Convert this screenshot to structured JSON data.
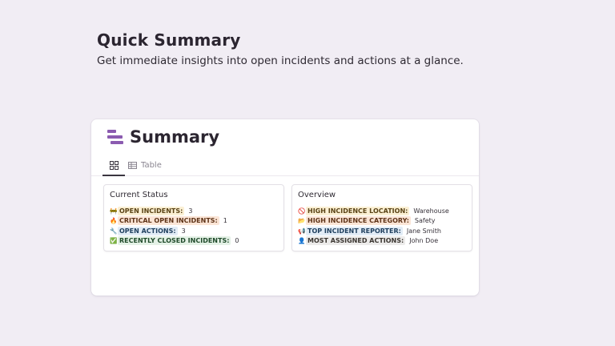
{
  "hero": {
    "title": "Quick Summary",
    "subtitle": "Get immediate insights into open incidents and actions at a glance."
  },
  "card": {
    "title": "Summary",
    "icon": "summary-bars-icon",
    "tabs": [
      {
        "label": "",
        "icon": "gallery-grid-icon",
        "active": true
      },
      {
        "label": "Table",
        "icon": "table-icon",
        "active": false
      }
    ]
  },
  "current_status": {
    "title": "Current Status",
    "items": [
      {
        "emoji": "🚧",
        "label": "OPEN INCIDENTS:",
        "value": "3",
        "color": "#fbf0d4"
      },
      {
        "emoji": "🔥",
        "label": "CRITICAL OPEN INCIDENTS:",
        "value": "1",
        "color": "#fbe5d6"
      },
      {
        "emoji": "🔧",
        "label": "OPEN ACTIONS:",
        "value": "3",
        "color": "#e2ecf6"
      },
      {
        "emoji": "✅",
        "label": "RECENTLY CLOSED INCIDENTS:",
        "value": "0",
        "color": "#e4f1e6"
      }
    ]
  },
  "overview": {
    "title": "Overview",
    "items": [
      {
        "emoji": "🚫",
        "label": "HIGH INCIDENCE LOCATION:",
        "value": "Warehouse",
        "color": "#fbf0d4"
      },
      {
        "emoji": "📂",
        "label": "HIGH INCIDENCE CATEGORY:",
        "value": "Safety",
        "color": "#fbe5d6"
      },
      {
        "emoji": "📢",
        "label": "TOP INCIDENT REPORTER:",
        "value": "Jane Smith",
        "color": "#e2ecf6"
      },
      {
        "emoji": "👤",
        "label": "MOST ASSIGNED ACTIONS:",
        "value": "John Doe",
        "color": "#ecebea"
      }
    ]
  }
}
